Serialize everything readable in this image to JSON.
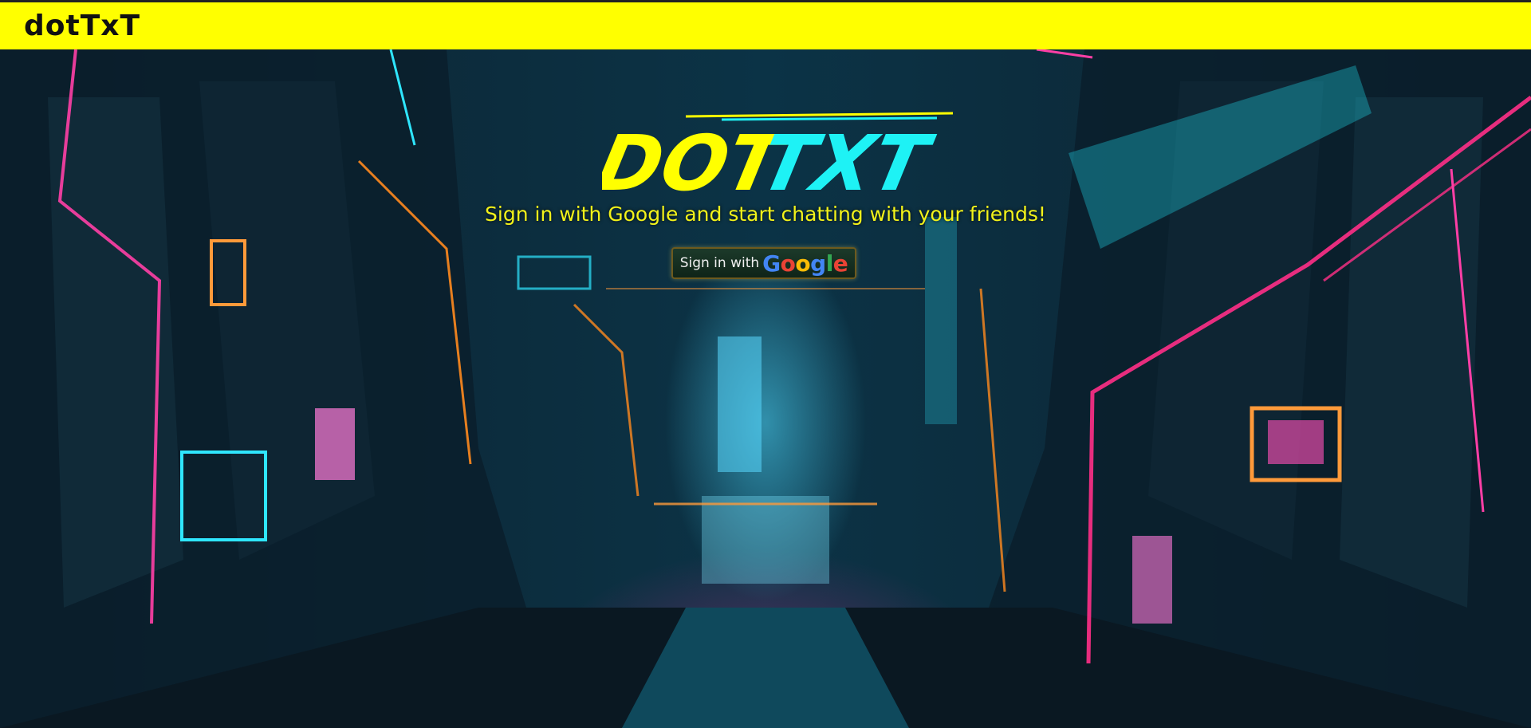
{
  "header": {
    "brand": "dotTxT",
    "background_color": "#ffff00"
  },
  "hero": {
    "logo_text": "DOTTXT",
    "logo_colors": {
      "primary": "#ffff00",
      "accent": "#1ef2f5"
    },
    "tagline": "Sign in with Google and start chatting with your friends!",
    "tagline_color": "#f2f21a",
    "background": "cyberpunk-neon-city-illustration"
  },
  "signin_button": {
    "prefix": "Sign in with",
    "google_letters": [
      {
        "ch": "G",
        "color": "#4285f4"
      },
      {
        "ch": "o",
        "color": "#ea4335"
      },
      {
        "ch": "o",
        "color": "#fbbc05"
      },
      {
        "ch": "g",
        "color": "#4285f4"
      },
      {
        "ch": "l",
        "color": "#34a853"
      },
      {
        "ch": "e",
        "color": "#ea4335"
      }
    ]
  }
}
